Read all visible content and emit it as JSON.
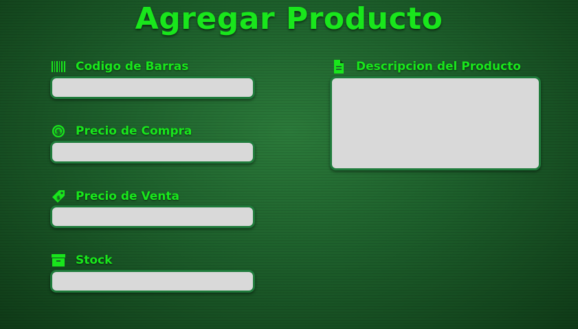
{
  "header": {
    "title": "Agregar Producto"
  },
  "form": {
    "barcode": {
      "label": "Codigo de Barras",
      "value": "",
      "icon": "barcode-icon"
    },
    "purchase_price": {
      "label": "Precio de Compra",
      "value": "",
      "icon": "money-coin-icon"
    },
    "sale_price": {
      "label": "Precio de Venta",
      "value": "",
      "icon": "price-tag-icon"
    },
    "stock": {
      "label": "Stock",
      "value": "",
      "icon": "archive-box-icon"
    },
    "description": {
      "label": "Descripcion del Producto",
      "value": "",
      "icon": "document-icon"
    }
  },
  "colors": {
    "accent": "#19e61c",
    "input_bg": "#d9d9d9",
    "input_border": "#1f7b3b"
  }
}
